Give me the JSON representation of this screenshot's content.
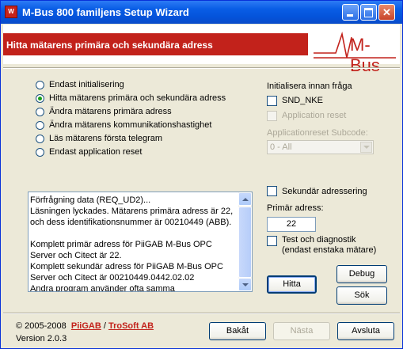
{
  "window": {
    "title": "M-Bus 800 familjens Setup Wizard",
    "icon_label": "W",
    "close_glyph": "✕"
  },
  "header": {
    "title": "Hitta mätarens primära och sekundära adress",
    "logo_text": "M-Bus"
  },
  "modes": [
    {
      "label": "Endast initialisering",
      "selected": false
    },
    {
      "label": "Hitta mätarens primära och sekundära adress",
      "selected": true
    },
    {
      "label": "Ändra mätarens primära adress",
      "selected": false
    },
    {
      "label": "Ändra mätarens kommunikationshastighet",
      "selected": false
    },
    {
      "label": "Läs mätarens första telegram",
      "selected": false
    },
    {
      "label": "Endast application reset",
      "selected": false
    }
  ],
  "init": {
    "heading": "Initialisera innan fråga",
    "snd_nke_label": "SND_NKE",
    "app_reset_label": "Application reset",
    "subcode_label": "Applicationreset Subcode:",
    "subcode_value": "0 - All"
  },
  "log": {
    "text": "Förfrågning data (REQ_UD2)...\nLäsningen lyckades. Mätarens primära adress är 22, och dess identifikationsnummer är 00210449 (ABB).\n\nKomplett primär adress för PiiGAB M-Bus OPC Server och Citect är 22.\nKomplett sekundär adress för PiiGAB M-Bus OPC Server och Citect är 00210449.0442.02.02\nAndra program använder ofta samma"
  },
  "addressing": {
    "secondary_label": "Sekundär adressering",
    "primary_label": "Primär adress:",
    "primary_value": "22",
    "test_label_line1": "Test och diagnostik",
    "test_label_line2": "(endast enstaka mätare)"
  },
  "buttons": {
    "hitta": "Hitta",
    "debug": "Debug",
    "sok": "Sök",
    "back": "Bakåt",
    "next": "Nästa",
    "finish": "Avsluta"
  },
  "footer": {
    "copyright": "© 2005-2008",
    "company1": "PiiGAB",
    "slash": "/",
    "company2": "TroSoft AB",
    "version": "Version 2.0.3"
  },
  "colors": {
    "brand_red": "#c2221b",
    "titlebar_blue": "#0453da",
    "window_bg": "#ece9d8"
  }
}
